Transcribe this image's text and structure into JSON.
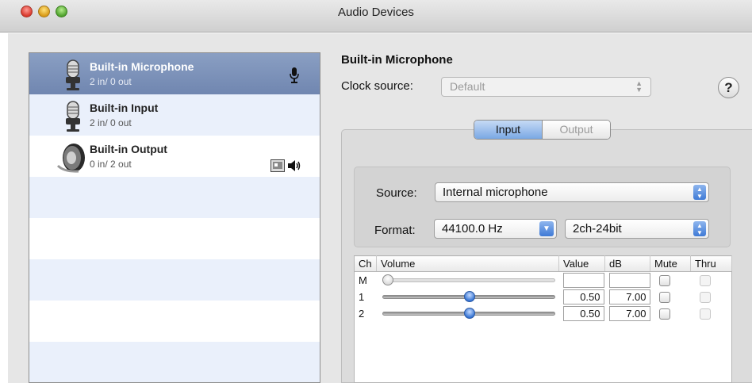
{
  "window": {
    "title": "Audio Devices"
  },
  "devices": [
    {
      "name": "Built-in Microphone",
      "io": "2 in/ 0 out",
      "icon": "microphone-icon",
      "status_icons": [
        "microphone-small-icon"
      ],
      "selected": true
    },
    {
      "name": "Built-in Input",
      "io": "2 in/ 0 out",
      "icon": "microphone-icon",
      "status_icons": [],
      "selected": false
    },
    {
      "name": "Built-in Output",
      "io": "0 in/ 2 out",
      "icon": "speaker-icon",
      "status_icons": [
        "finder-icon",
        "volume-icon"
      ],
      "selected": false
    }
  ],
  "detail": {
    "device_name": "Built-in Microphone",
    "clock_source_label": "Clock source:",
    "clock_source_value": "Default",
    "help_label": "?",
    "tabs": [
      {
        "label": "Input",
        "active": true
      },
      {
        "label": "Output",
        "active": false
      }
    ],
    "source_label": "Source:",
    "source_value": "Internal microphone",
    "format_label": "Format:",
    "sample_rate": "44100.0 Hz",
    "bit_format": "2ch-24bit"
  },
  "channels": {
    "headers": {
      "ch": "Ch",
      "volume": "Volume",
      "value": "Value",
      "db": "dB",
      "mute": "Mute",
      "thru": "Thru"
    },
    "rows": [
      {
        "ch": "M",
        "level": 0.0,
        "value": "",
        "db": "",
        "enabled": false
      },
      {
        "ch": "1",
        "level": 0.5,
        "value": "0.50",
        "db": "7.00",
        "enabled": true
      },
      {
        "ch": "2",
        "level": 0.5,
        "value": "0.50",
        "db": "7.00",
        "enabled": true
      }
    ]
  },
  "colors": {
    "selection": "#7a90b9",
    "accent": "#3f7ad6",
    "alt_row": "#eaf0fb"
  }
}
